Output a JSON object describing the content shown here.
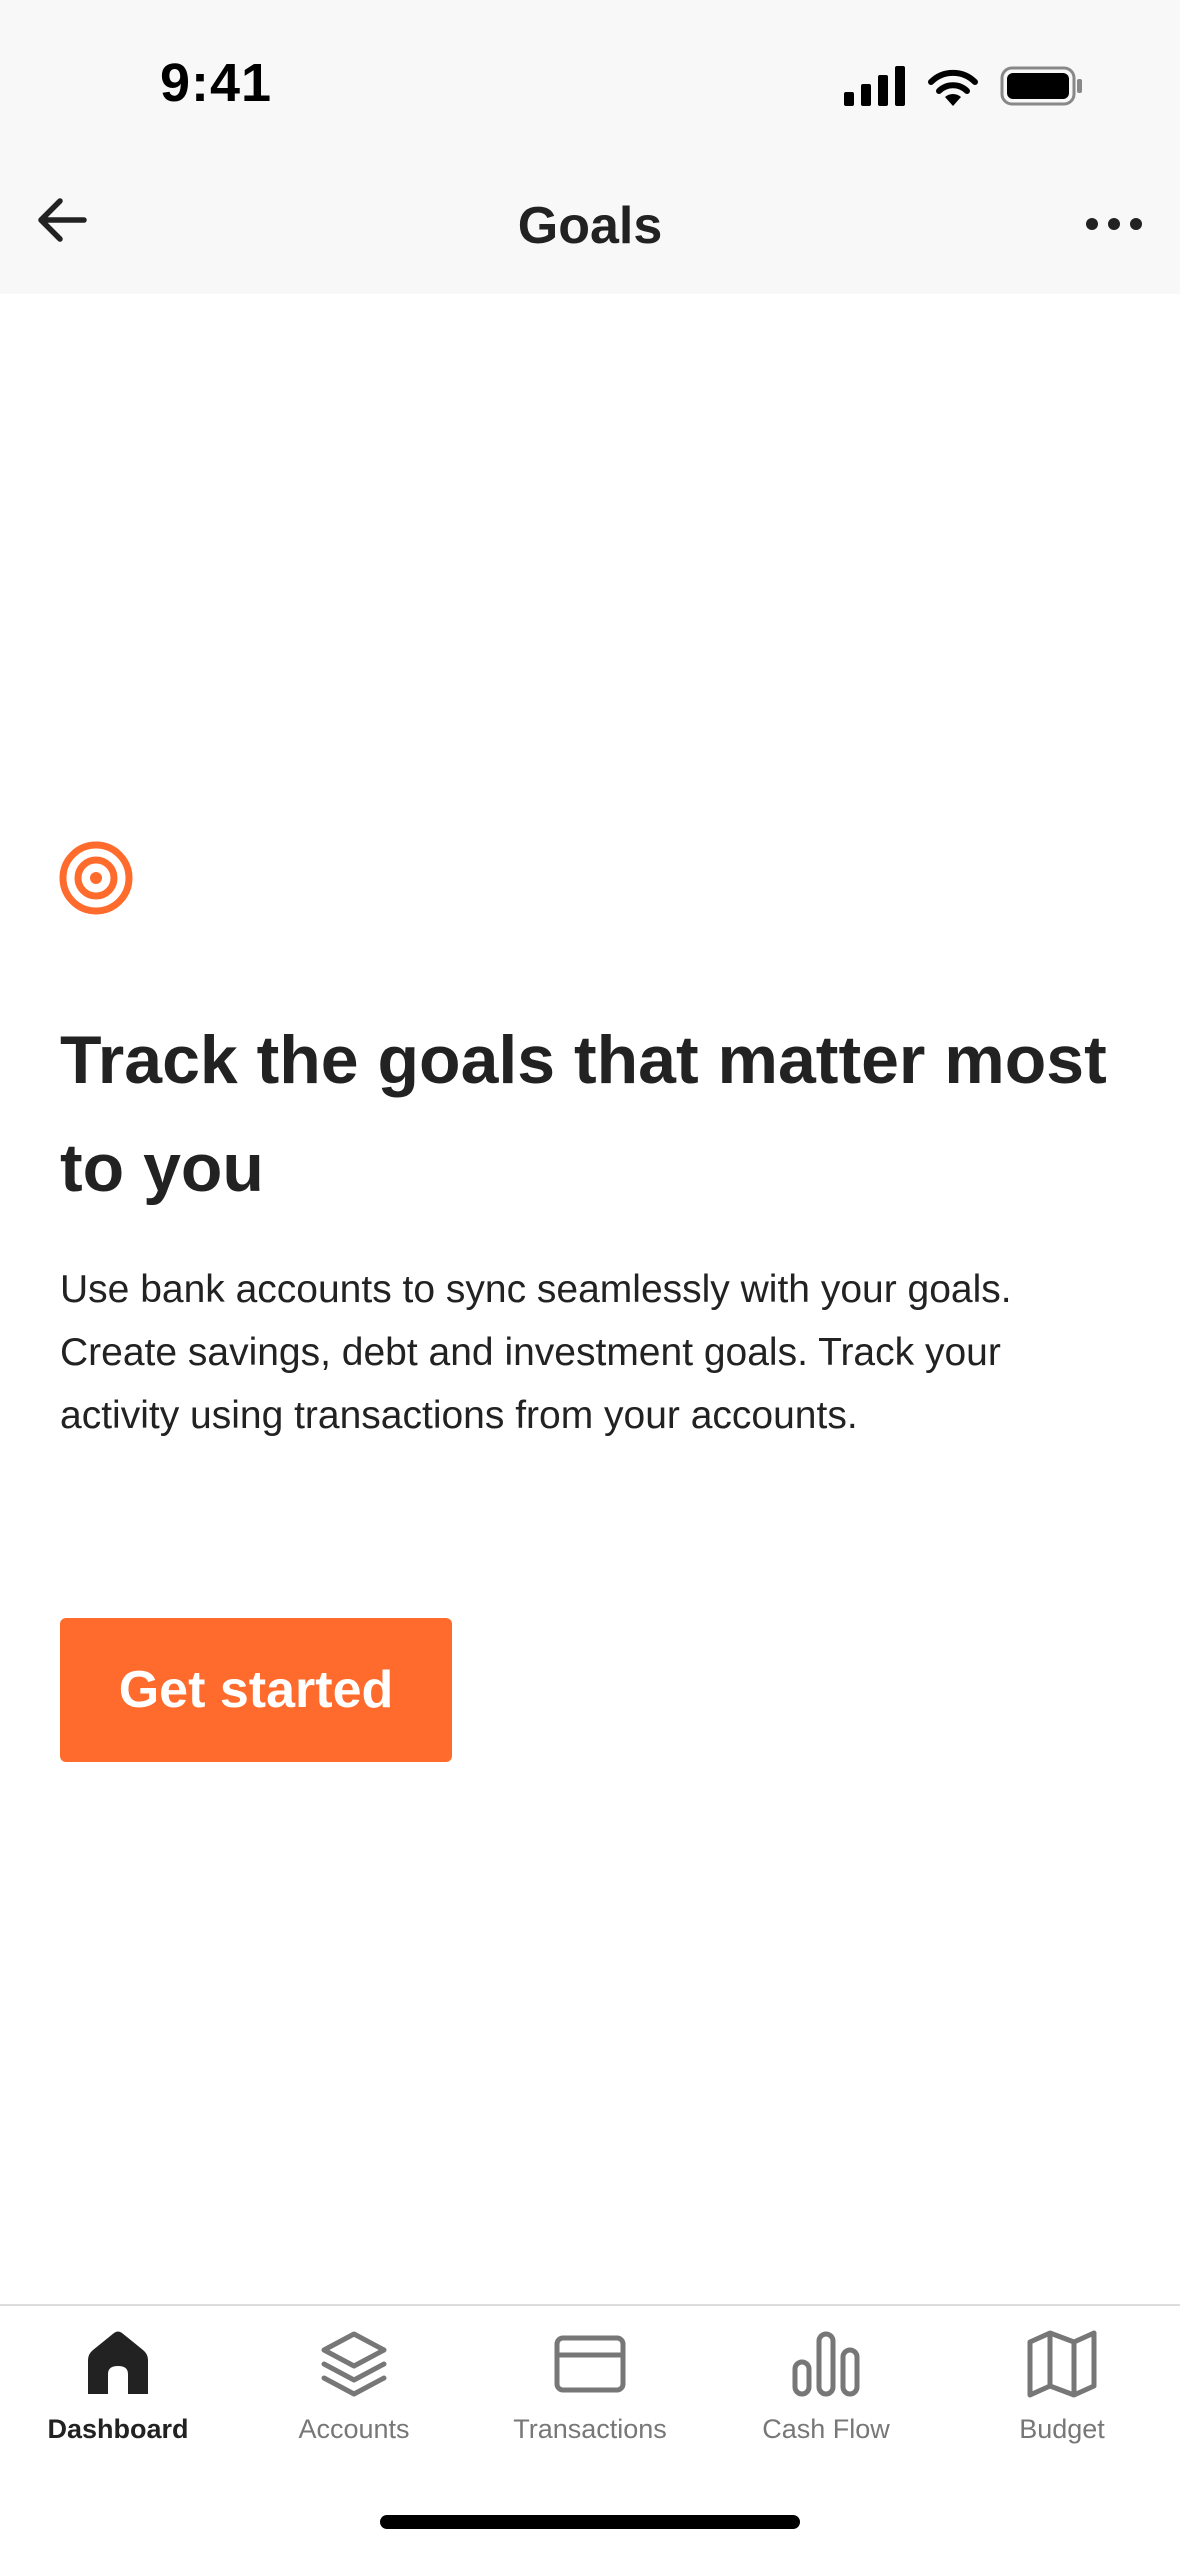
{
  "status_bar": {
    "time": "9:41"
  },
  "nav": {
    "title": "Goals",
    "back_icon": "arrow-left-icon",
    "more_icon": "more-horizontal-icon"
  },
  "content": {
    "icon": "target-icon",
    "headline": "Track the goals that matter most to you",
    "body": "Use bank accounts to sync seamlessly with your goals. Create savings, debt and investment goals. Track your activity using transactions from your accounts.",
    "cta_label": "Get started"
  },
  "tabs": [
    {
      "label": "Dashboard",
      "icon": "home-icon",
      "active": true
    },
    {
      "label": "Accounts",
      "icon": "layers-icon",
      "active": false
    },
    {
      "label": "Transactions",
      "icon": "credit-card-icon",
      "active": false
    },
    {
      "label": "Cash Flow",
      "icon": "bar-chart-icon",
      "active": false
    },
    {
      "label": "Budget",
      "icon": "map-icon",
      "active": false
    }
  ],
  "colors": {
    "accent": "#FF6B2C",
    "text": "#222222",
    "muted": "#777777",
    "header_bg": "#F8F8F8"
  }
}
